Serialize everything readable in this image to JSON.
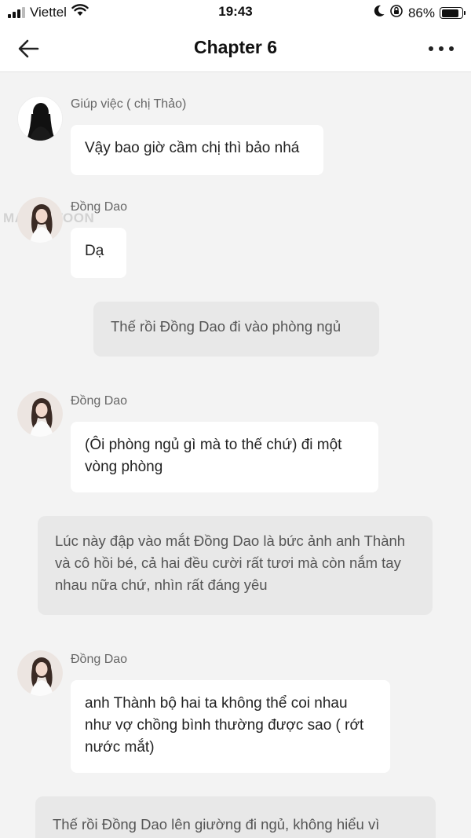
{
  "status_bar": {
    "carrier": "Viettel",
    "time": "19:43",
    "battery": "86%",
    "battery_level": 0.86
  },
  "nav": {
    "title": "Chapter 6",
    "back_icon": "arrow-left-icon",
    "more_icon": "more-horizontal-icon"
  },
  "watermark": "MANGATOON",
  "messages": [
    {
      "speaker": "Giúp việc ( chị Thảo)",
      "text": "Vậy bao giờ cầm chị thì bảo nhá"
    },
    {
      "speaker": "Đồng Dao",
      "text": "Dạ"
    },
    {
      "narration": "Thế rồi Đồng Dao đi vào phòng ngủ"
    },
    {
      "speaker": "Đồng Dao",
      "text": "(Ôi phòng ngủ gì mà to thế chứ) đi một vòng phòng"
    },
    {
      "narration": "Lúc này đập vào mắt Đồng Dao là bức ảnh anh Thành và cô hồi bé, cả hai đều cười rất tươi mà còn nắm tay nhau nữa chứ, nhìn rất đáng yêu"
    },
    {
      "speaker": "Đồng Dao",
      "text": "anh Thành bộ hai ta không thể coi nhau như vợ chồng bình thường được sao ( rớt nước mắt)"
    },
    {
      "narration": "Thế rồi Đồng Dao lên giường đi ngủ, không hiểu vì"
    }
  ]
}
